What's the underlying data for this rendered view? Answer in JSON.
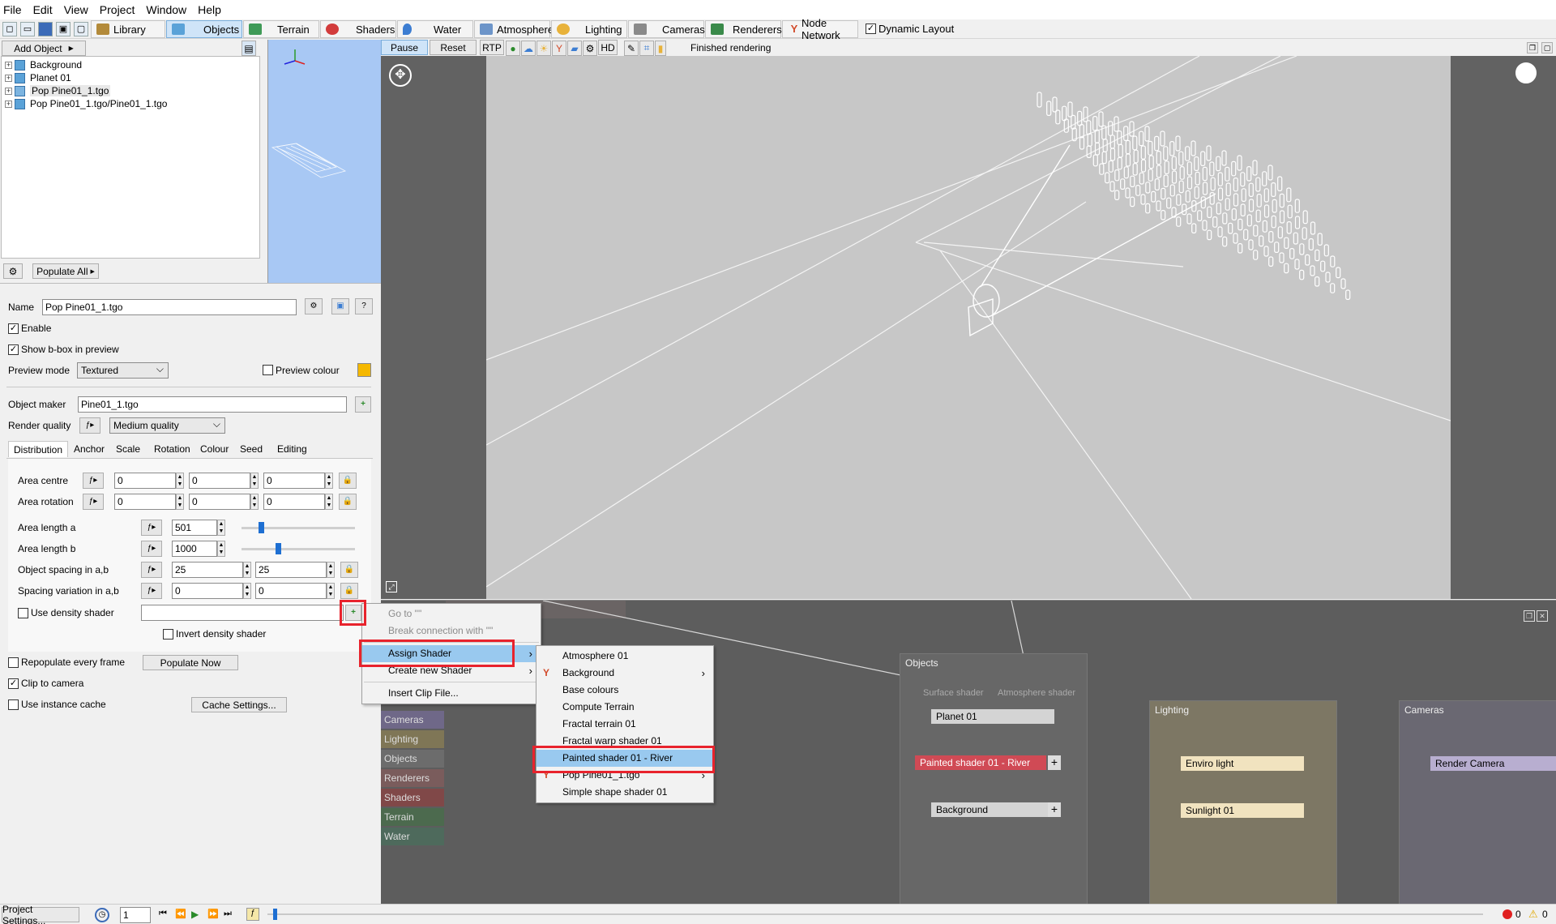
{
  "menubar": {
    "items": [
      "File",
      "Edit",
      "View",
      "Project",
      "Window",
      "Help"
    ]
  },
  "toolbar": {
    "tabs": [
      {
        "label": "Library",
        "color": "#b38a3a"
      },
      {
        "label": "Objects",
        "color": "#5aa2d8"
      },
      {
        "label": "Terrain",
        "color": "#3f9a57"
      },
      {
        "label": "Shaders",
        "color": "#d23c3c"
      },
      {
        "label": "Water",
        "color": "#3c7dd2"
      },
      {
        "label": "Atmosphere",
        "color": "#6d95c9"
      },
      {
        "label": "Lighting",
        "color": "#e8b23a"
      },
      {
        "label": "Cameras",
        "color": "#8a8a8a"
      },
      {
        "label": "Renderers",
        "color": "#3a8a4a"
      },
      {
        "label": "Node Network",
        "color": "#d24a2a"
      }
    ],
    "dynamic_layout": "Dynamic Layout"
  },
  "objects_panel": {
    "add_object": "Add Object",
    "populate_all": "Populate All",
    "tree": [
      "Background",
      "Planet 01",
      "Pop Pine01_1.tgo",
      "Pop Pine01_1.tgo/Pine01_1.tgo"
    ]
  },
  "viewport": {
    "pause": "Pause",
    "reset": "Reset",
    "rtp": "RTP",
    "hd": "HD",
    "status": "Finished rendering"
  },
  "props": {
    "name_label": "Name",
    "name_value": "Pop Pine01_1.tgo",
    "enable": "Enable",
    "show_bbox": "Show b-box in preview",
    "preview_mode_label": "Preview mode",
    "preview_mode_value": "Textured",
    "preview_colour": "Preview colour",
    "preview_colour_value": "#f5b800",
    "object_maker_label": "Object maker",
    "object_maker_value": "Pine01_1.tgo",
    "render_quality_label": "Render quality",
    "render_quality_value": "Medium quality",
    "tabs": [
      "Distribution",
      "Anchor",
      "Scale",
      "Rotation",
      "Colour",
      "Seed",
      "Editing"
    ],
    "area_centre_label": "Area centre",
    "area_centre": [
      "0",
      "0",
      "0"
    ],
    "area_rotation_label": "Area rotation",
    "area_rotation": [
      "0",
      "0",
      "0"
    ],
    "area_length_a_label": "Area length a",
    "area_length_a": "501",
    "area_length_a_level": 0.15,
    "area_length_b_label": "Area length b",
    "area_length_b": "1000",
    "area_length_b_level": 0.3,
    "object_spacing_label": "Object spacing in a,b",
    "object_spacing": [
      "25",
      "25"
    ],
    "spacing_variation_label": "Spacing variation in a,b",
    "spacing_variation": [
      "0",
      "0"
    ],
    "use_density_shader": "Use density shader",
    "invert_density_shader": "Invert density shader",
    "repopulate": "Repopulate every frame",
    "populate_now": "Populate Now",
    "clip_to_camera": "Clip to camera",
    "use_instance_cache": "Use instance cache",
    "cache_settings": "Cache Settings..."
  },
  "context_menu": {
    "items": [
      {
        "label": "Go to \"\"",
        "disabled": true
      },
      {
        "label": "Break connection with \"\"",
        "disabled": true
      },
      {
        "label": "Assign Shader",
        "submenu": true
      },
      {
        "label": "Create new Shader",
        "submenu": true
      },
      {
        "label": "Insert Clip File..."
      }
    ]
  },
  "submenu": {
    "items": [
      "Atmosphere 01",
      "Background",
      "Base colours",
      "Compute Terrain",
      "Fractal terrain 01",
      "Fractal warp shader 01",
      "Painted shader 01 - River",
      "Pop Pine01_1.tgo",
      "Simple shape shader 01"
    ]
  },
  "node_network": {
    "categories": [
      "Cameras",
      "Lighting",
      "Objects",
      "Renderers",
      "Shaders",
      "Terrain",
      "Water"
    ],
    "groups": {
      "objects": "Objects",
      "lighting": "Lighting",
      "cameras": "Cameras"
    },
    "ports": [
      "Surface shader",
      "Atmosphere shader"
    ],
    "nodes": {
      "planet": "Planet 01",
      "painted": "Painted shader 01 - River",
      "background": "Background",
      "enviro": "Enviro light",
      "sunlight": "Sunlight 01",
      "camera": "Render Camera"
    }
  },
  "status": {
    "project_settings": "Project Settings...",
    "frame": "1",
    "errors": "0",
    "warnings": "0"
  }
}
